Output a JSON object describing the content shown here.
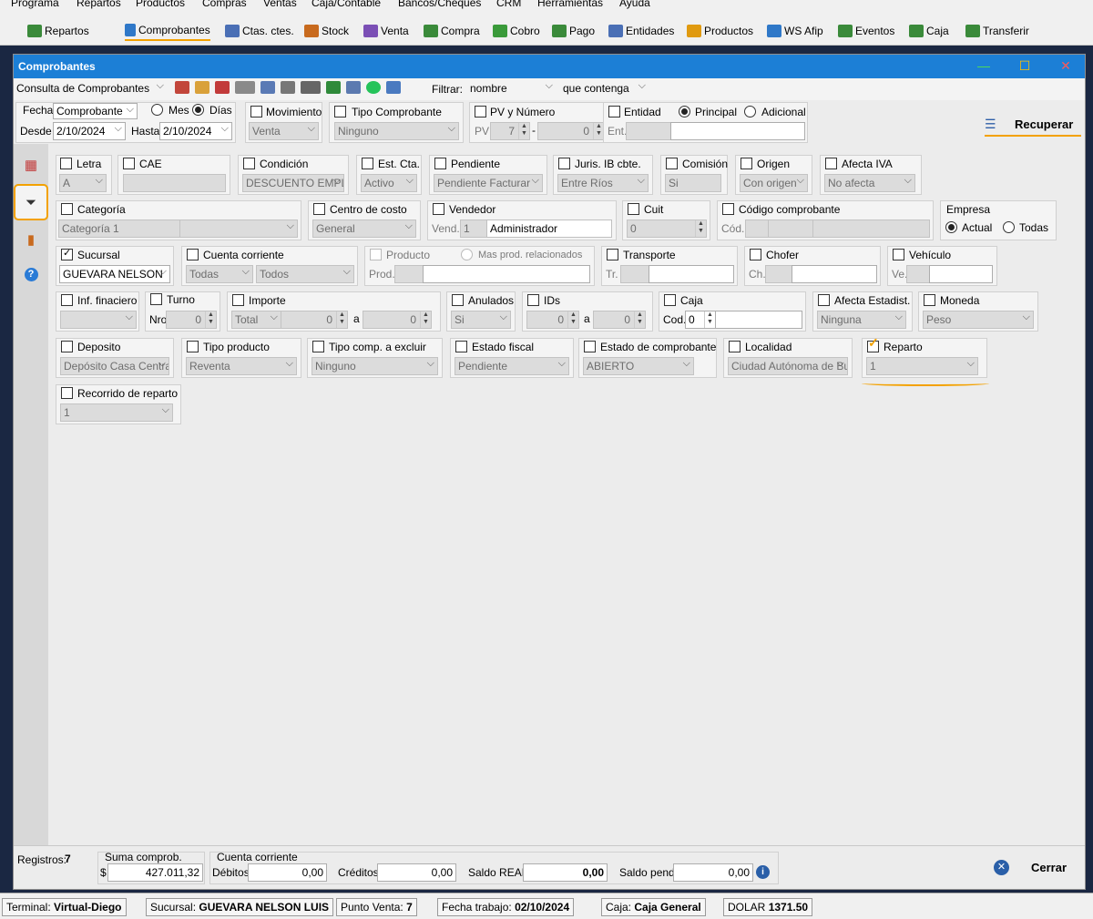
{
  "menu": [
    "Programa",
    "Repartos",
    "Productos",
    "Compras",
    "Ventas",
    "Caja/Contable",
    "Bancos/Cheques",
    "CRM",
    "Herramientas",
    "Ayuda"
  ],
  "toolbar": [
    {
      "label": "Repartos",
      "icon": "truck-icon",
      "color": "#3a8a3a"
    },
    {
      "label": "Comprobantes",
      "icon": "document-icon",
      "color": "#2f78c8"
    },
    {
      "label": "Ctas. ctes.",
      "icon": "accounts-icon",
      "color": "#4a6fb5"
    },
    {
      "label": "Stock",
      "icon": "stock-icon",
      "color": "#c86a1e"
    },
    {
      "label": "Venta",
      "icon": "sale-icon",
      "color": "#7b4fb5"
    },
    {
      "label": "Compra",
      "icon": "cart-icon",
      "color": "#3a8a3a"
    },
    {
      "label": "Cobro",
      "icon": "cash-icon",
      "color": "#3a9a3a"
    },
    {
      "label": "Pago",
      "icon": "payment-icon",
      "color": "#3a8a3a"
    },
    {
      "label": "Entidades",
      "icon": "entities-icon",
      "color": "#4a6fb5"
    },
    {
      "label": "Productos",
      "icon": "products-icon",
      "color": "#e09a10"
    },
    {
      "label": "WS Afip",
      "icon": "plug-icon",
      "color": "#2f78c8"
    },
    {
      "label": "Eventos",
      "icon": "runner-icon",
      "color": "#3a8a3a"
    },
    {
      "label": "Caja",
      "icon": "register-icon",
      "color": "#3a8a3a"
    },
    {
      "label": "Transferir",
      "icon": "transfer-icon",
      "color": "#3a8a3a"
    }
  ],
  "window": {
    "title": "Comprobantes",
    "minimize": "—",
    "maximize": "☐",
    "close": "✕"
  },
  "row1": {
    "consulta": "Consulta de Comprobantes",
    "filtrar_label": "Filtrar:",
    "filtrar_field": "nombre",
    "filtrar_mode": "que contenga"
  },
  "fecha": {
    "label": "Fecha",
    "tipo": "Comprobante",
    "mes": "Mes",
    "dias": "Días",
    "desde_label": "Desde",
    "desde": "2/10/2024",
    "hasta_label": "Hasta",
    "hasta": "2/10/2024"
  },
  "movimiento": {
    "label": "Movimiento",
    "value": "Venta"
  },
  "tipo_comprobante": {
    "label": "Tipo Comprobante",
    "value": "Ninguno"
  },
  "pv_numero": {
    "label": "PV y Número",
    "pv_label": "PV",
    "pv": "7",
    "dash": "-",
    "numero": "0"
  },
  "entidad": {
    "label": "Entidad",
    "principal": "Principal",
    "adicional": "Adicional",
    "ent_label": "Ent."
  },
  "recuperar": {
    "label": "Recuperar"
  },
  "filters": {
    "letra": {
      "label": "Letra",
      "value": "A"
    },
    "cae": {
      "label": "CAE"
    },
    "condicion": {
      "label": "Condición",
      "value": "DESCUENTO EMPL"
    },
    "est_cta": {
      "label": "Est. Cta.",
      "value": "Activo"
    },
    "pendiente": {
      "label": "Pendiente",
      "value": "Pendiente Facturar"
    },
    "juris": {
      "label": "Juris. IB cbte.",
      "value": "Entre Ríos"
    },
    "comision": {
      "label": "Comisión",
      "value": "Si"
    },
    "origen": {
      "label": "Origen",
      "value": "Con origen"
    },
    "afecta_iva": {
      "label": "Afecta IVA",
      "value": "No afecta"
    },
    "categoria": {
      "label": "Categoría",
      "value": "Categoría 1"
    },
    "centro_costo": {
      "label": "Centro de costo",
      "value": "General"
    },
    "vendedor": {
      "label": "Vendedor",
      "vend_label": "Vend.",
      "code": "1",
      "name": "Administrador"
    },
    "cuit": {
      "label": "Cuit",
      "value": "0"
    },
    "codigo_comprobante": {
      "label": "Código comprobante",
      "cod_label": "Cód."
    },
    "empresa": {
      "label": "Empresa",
      "actual": "Actual",
      "todas": "Todas"
    },
    "sucursal": {
      "label": "Sucursal",
      "value": "GUEVARA NELSON"
    },
    "cuenta_corriente": {
      "label": "Cuenta corriente",
      "value1": "Todas",
      "value2": "Todos"
    },
    "producto": {
      "label": "Producto",
      "mas": "Mas prod. relacionados",
      "prod_label": "Prod."
    },
    "transporte": {
      "label": "Transporte",
      "tr_label": "Tr."
    },
    "chofer": {
      "label": "Chofer",
      "ch_label": "Ch."
    },
    "vehiculo": {
      "label": "Vehículo",
      "ve_label": "Ve."
    },
    "inf_financiero": {
      "label": "Inf. finaciero"
    },
    "turno": {
      "label": "Turno",
      "nro_label": "Nro",
      "value": "0"
    },
    "importe": {
      "label": "Importe",
      "tipo": "Total",
      "from": "0",
      "a": "a",
      "to": "0"
    },
    "anulados": {
      "label": "Anulados",
      "value": "Si"
    },
    "ids": {
      "label": "IDs",
      "from": "0",
      "a": "a",
      "to": "0"
    },
    "caja": {
      "label": "Caja",
      "cod_label": "Cod.",
      "value": "0"
    },
    "afecta_estadist": {
      "label": "Afecta Estadist.",
      "value": "Ninguna"
    },
    "moneda": {
      "label": "Moneda",
      "value": "Peso"
    },
    "deposito": {
      "label": "Deposito",
      "value": "Depósito Casa Central"
    },
    "tipo_producto": {
      "label": "Tipo producto",
      "value": "Reventa"
    },
    "tipo_comp_excluir": {
      "label": "Tipo comp. a excluir",
      "value": "Ninguno"
    },
    "estado_fiscal": {
      "label": "Estado fiscal",
      "value": "Pendiente"
    },
    "estado_comprobante": {
      "label": "Estado  de comprobante",
      "value": "ABIERTO"
    },
    "localidad": {
      "label": "Localidad",
      "value": "Ciudad Autónoma de Buenos Aires"
    },
    "reparto": {
      "label": "Reparto",
      "value": "1"
    },
    "recorrido": {
      "label": "Recorrido de reparto",
      "value": "1"
    }
  },
  "footer": {
    "registros_label": "Registros:",
    "registros": "7",
    "suma_label": "Suma comprob.",
    "currency": "$",
    "suma": "427.011,32",
    "cc_label": "Cuenta corriente",
    "debitos_label": "Débitos",
    "debitos": "0,00",
    "creditos_label": "Créditos",
    "creditos": "0,00",
    "saldo_real_label": "Saldo REAL",
    "saldo_real": "0,00",
    "saldo_pend_label": "Saldo pend.",
    "saldo_pend": "0,00",
    "cerrar": "Cerrar"
  },
  "status": {
    "terminal_label": "Terminal:",
    "terminal": "Virtual-Diego",
    "sucursal_label": "Sucursal:",
    "sucursal": "GUEVARA NELSON LUIS",
    "pv_label": "Punto Venta:",
    "pv": "7",
    "fecha_label": "Fecha trabajo:",
    "fecha": "02/10/2024",
    "caja_label": "Caja:",
    "caja": "Caja General",
    "dolar_label": "DOLAR",
    "dolar": "1371.50"
  },
  "colors": {
    "titlebar": "#1c7fd6",
    "highlight": "#f3a100"
  }
}
